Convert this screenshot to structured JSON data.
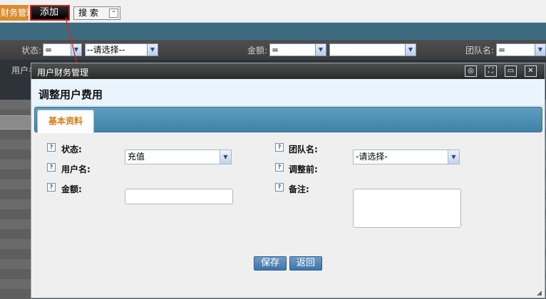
{
  "topbar": {
    "menu_tab": "财务管理",
    "add_label": "添加",
    "search_label": "搜 索",
    "search_chevron": "⌃"
  },
  "filters": {
    "status_label": "状态:",
    "status_op": "=",
    "status_value": "--请选择--",
    "amount_label": "金额:",
    "amount_op": "=",
    "amount_value": "",
    "team_label": "团队名:",
    "team_op": "=",
    "username_label": "用户名"
  },
  "dialog": {
    "title": "用户财务管理",
    "heading": "调整用户费用",
    "tab_basic": "基本资料",
    "fields": {
      "status_label": "状态:",
      "status_value": "充值",
      "team_label": "团队名:",
      "team_value": "-请选择-",
      "username_label": "用户名:",
      "before_label": "调整前:",
      "amount_label": "金额:",
      "amount_value": "",
      "remark_label": "备注:",
      "remark_value": ""
    },
    "save_label": "保存",
    "back_label": "返回"
  },
  "icons": {
    "help": "?",
    "dropdown": "▼"
  },
  "colors": {
    "accent_orange": "#d27c12",
    "tab_blue": "#4d90b5",
    "button_blue": "#4f7fb0",
    "highlight_red": "#c71e1e"
  }
}
